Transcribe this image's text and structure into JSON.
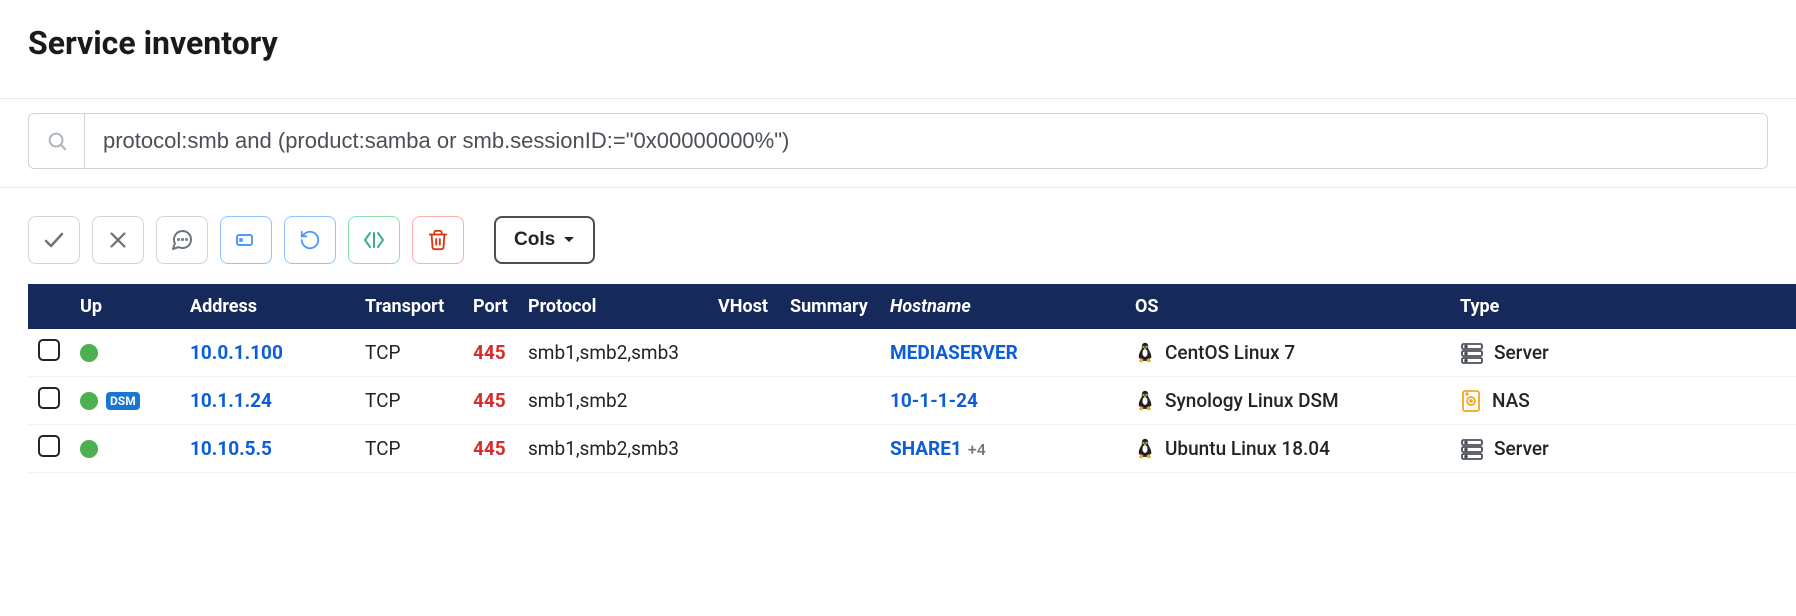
{
  "page": {
    "title": "Service inventory"
  },
  "search": {
    "value": "protocol:smb and (product:samba or smb.sessionID:=\"0x00000000%\")"
  },
  "toolbar": {
    "cols_label": "Cols"
  },
  "table": {
    "headers": {
      "up": "Up",
      "address": "Address",
      "transport": "Transport",
      "port": "Port",
      "protocol": "Protocol",
      "vhost": "VHost",
      "summary": "Summary",
      "hostname": "Hostname",
      "os": "OS",
      "type": "Type"
    },
    "rows": [
      {
        "up_badge": "",
        "address": "10.0.1.100",
        "transport": "TCP",
        "port": "445",
        "protocol": "smb1,smb2,smb3",
        "vhost": "",
        "summary": "",
        "hostname": "MEDIASERVER",
        "hostname_extra": "",
        "os": "CentOS Linux 7",
        "os_icon": "tux",
        "type": "Server",
        "type_icon": "server"
      },
      {
        "up_badge": "DSM",
        "address": "10.1.1.24",
        "transport": "TCP",
        "port": "445",
        "protocol": "smb1,smb2",
        "vhost": "",
        "summary": "",
        "hostname": "10-1-1-24",
        "hostname_extra": "",
        "os": "Synology Linux DSM",
        "os_icon": "tux",
        "type": "NAS",
        "type_icon": "nas"
      },
      {
        "up_badge": "",
        "address": "10.10.5.5",
        "transport": "TCP",
        "port": "445",
        "protocol": "smb1,smb2,smb3",
        "vhost": "",
        "summary": "",
        "hostname": "SHARE1",
        "hostname_extra": "+4",
        "os": "Ubuntu Linux 18.04",
        "os_icon": "tux",
        "type": "Server",
        "type_icon": "server"
      }
    ]
  }
}
